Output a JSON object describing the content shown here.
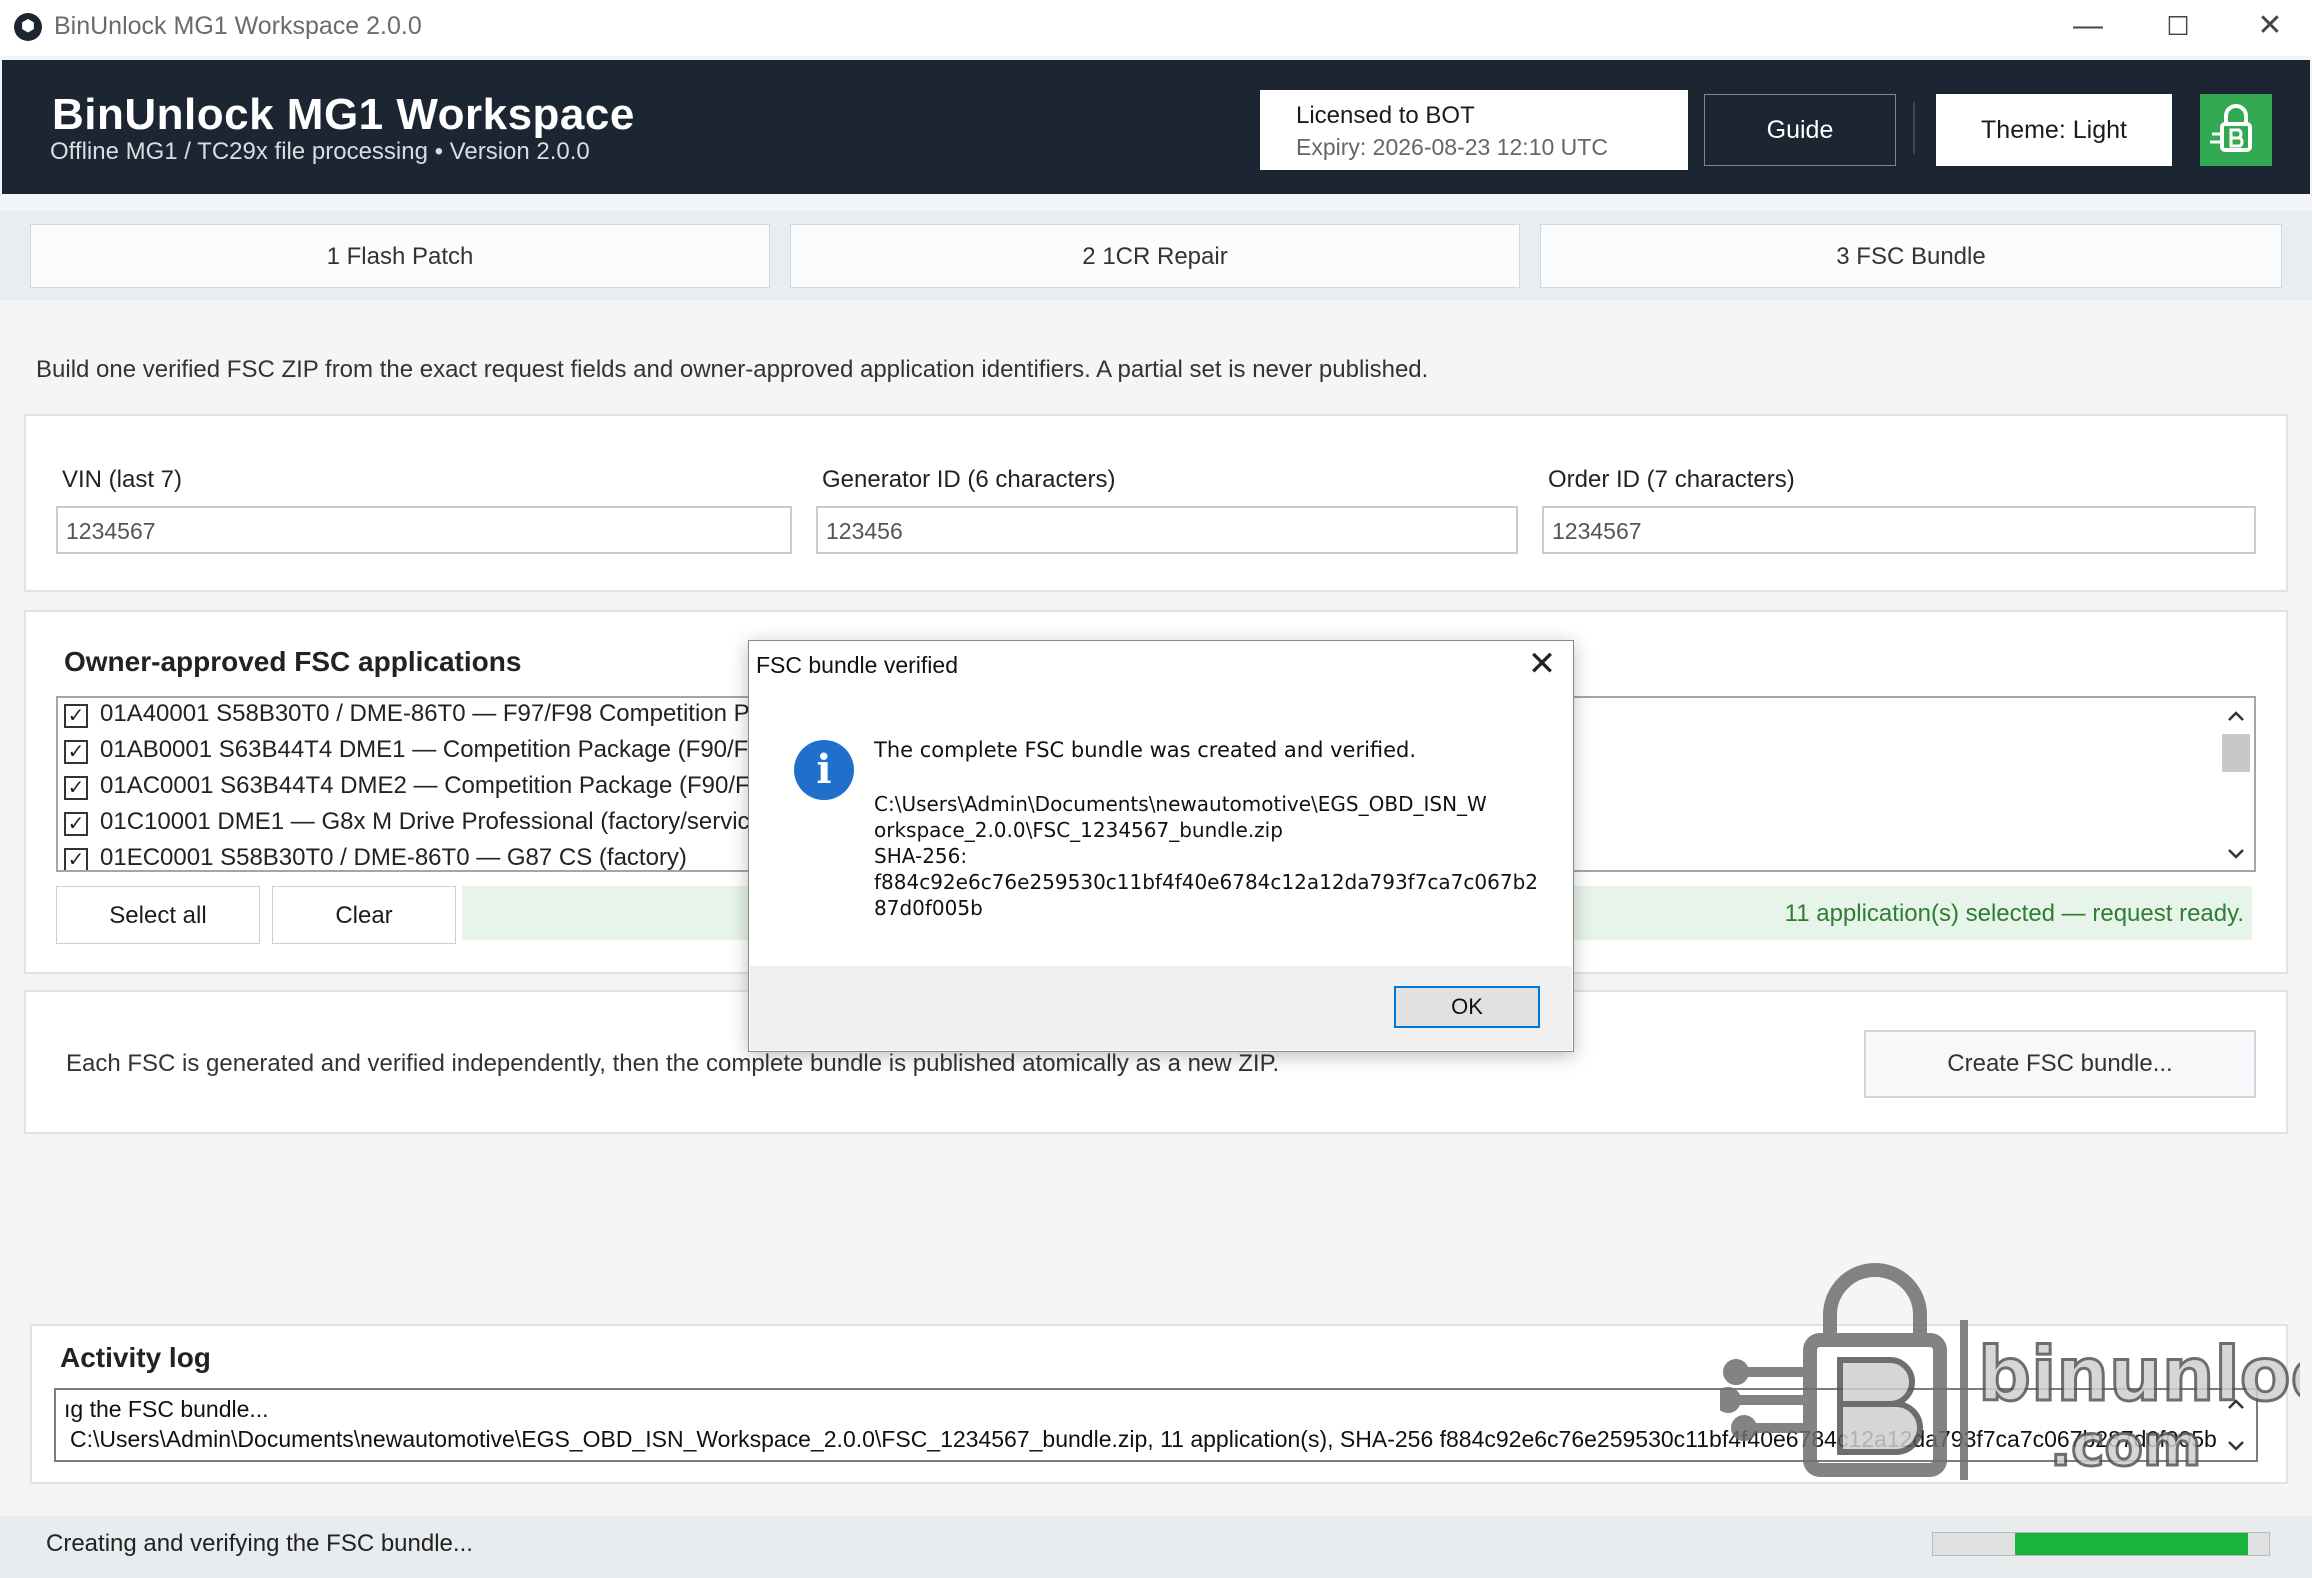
{
  "window": {
    "title": "BinUnlock MG1 Workspace 2.0.0",
    "controls": {
      "minimize": "—",
      "maximize": "☐",
      "close": "✕"
    }
  },
  "header": {
    "title": "BinUnlock MG1 Workspace",
    "subtitle": "Offline MG1 / TC29x file processing • Version 2.0.0",
    "license_name": "Licensed to BOT",
    "license_expiry": "Expiry: 2026-08-23 12:10 UTC",
    "guide_label": "Guide",
    "theme_label": "Theme: Light"
  },
  "tabs": [
    {
      "label": "1  Flash Patch"
    },
    {
      "label": "2  1CR Repair"
    },
    {
      "label": "3  FSC Bundle"
    }
  ],
  "intro": "Build one verified FSC ZIP from the exact request fields and owner-approved application identifiers. A partial set is never published.",
  "fields": {
    "vin": {
      "label": "VIN (last 7)",
      "value": "1234567"
    },
    "generator": {
      "label": "Generator ID (6 characters)",
      "value": "123456"
    },
    "order": {
      "label": "Order ID (7 characters)",
      "value": "1234567"
    }
  },
  "apps": {
    "title": "Owner-approved FSC applications",
    "items": [
      {
        "label": "01A40001  S58B30T0 / DME-86T0 — F97/F98 Competition Pack",
        "checked": true
      },
      {
        "label": "01AB0001  S63B44T4 DME1 — Competition Package (F90/F91/",
        "checked": true
      },
      {
        "label": "01AC0001  S63B44T4 DME2 — Competition Package (F90/F91/",
        "checked": true
      },
      {
        "label": "01C10001  DME1 — G8x M Drive Professional (factory/service)",
        "checked": true
      },
      {
        "label": "01EC0001  S58B30T0 / DME-86T0 — G87 CS (factory)",
        "checked": true
      }
    ],
    "select_all_label": "Select all",
    "clear_label": "Clear",
    "status": "11 application(s) selected — request ready."
  },
  "bundle": {
    "description": "Each FSC is generated and verified independently, then the complete bundle is published atomically as a new ZIP.",
    "create_label": "Create FSC bundle..."
  },
  "log": {
    "title": "Activity log",
    "lines": [
      "ıg the FSC bundle...",
      "C:\\Users\\Admin\\Documents\\newautomotive\\EGS_OBD_ISN_Workspace_2.0.0\\FSC_1234567_bundle.zip, 11 application(s), SHA-256 f884c92e6c76e259530c11bf4f40e6784c12a12da793f7ca7c067b287d0f005b."
    ]
  },
  "statusbar": {
    "text": "Creating and verifying the FSC bundle...",
    "progress": 0.76
  },
  "watermark": {
    "brand": "binunlock",
    "suffix": ".com"
  },
  "dialog": {
    "title": "FSC bundle verified",
    "message": "The complete FSC bundle was created and verified.",
    "path_line1": "C:\\Users\\Admin\\Documents\\newautomotive\\EGS_OBD_ISN_W",
    "path_line2": "orkspace_2.0.0\\FSC_1234567_bundle.zip",
    "hash_label": "SHA-256:",
    "hash_line1": "f884c92e6c76e259530c11bf4f40e6784c12a12da793f7ca7c067b2",
    "hash_line2": "87d0f005b",
    "ok_label": "OK",
    "close_glyph": "✕",
    "icon_glyph": "i"
  },
  "colors": {
    "header_bg": "#1b2632",
    "accent_green": "#33a853",
    "status_green": "#2e7d32",
    "progress_green": "#18b43c",
    "dialog_icon_blue": "#1f6fcc"
  }
}
